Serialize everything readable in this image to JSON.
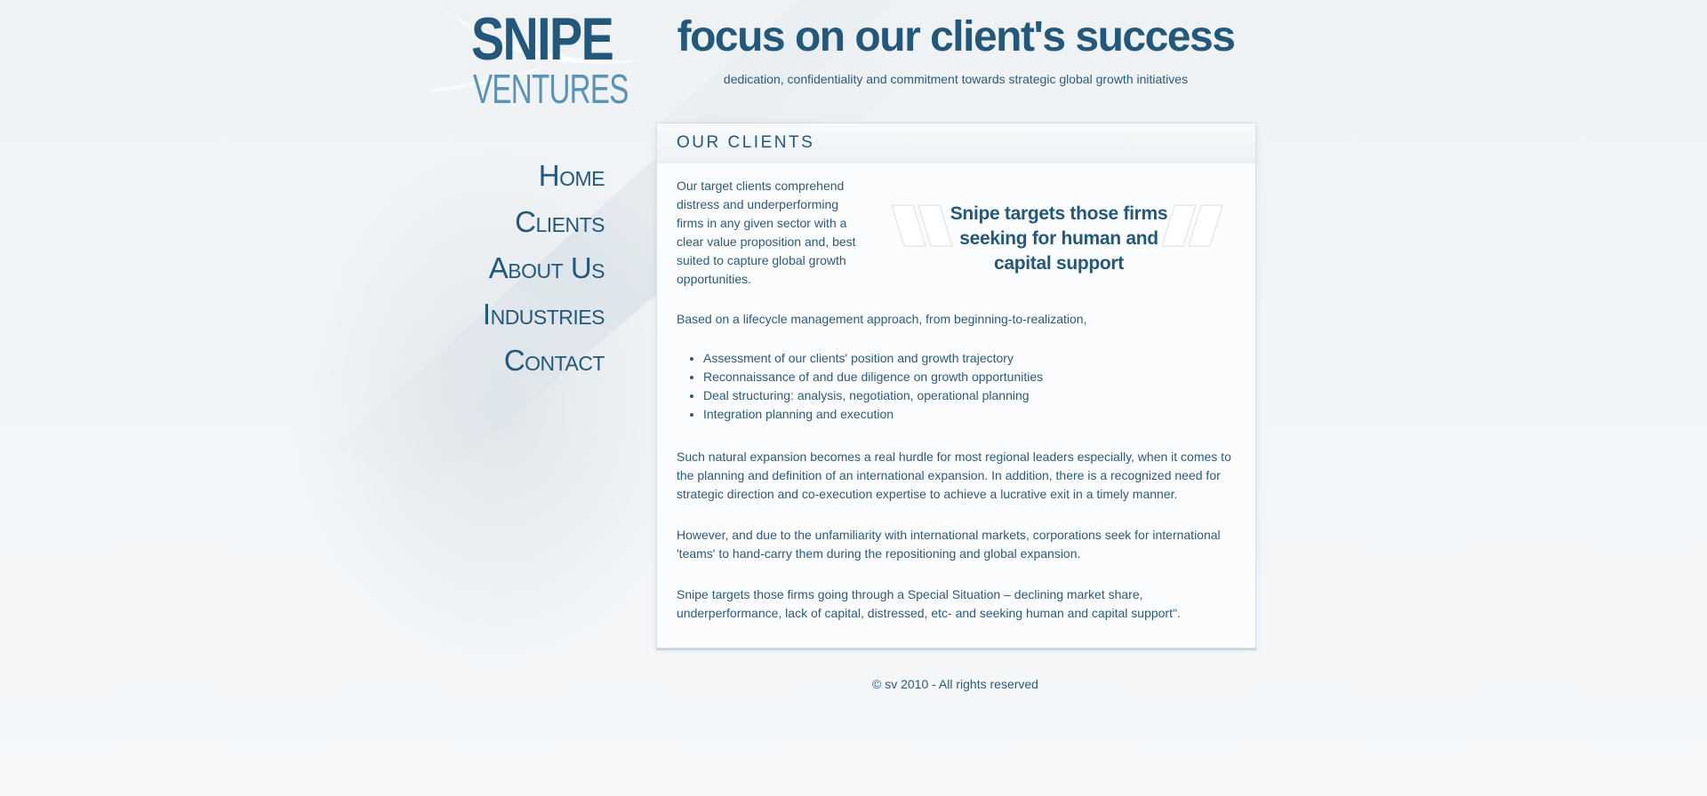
{
  "logo": {
    "line1": "SNIPE",
    "line2": "VENTURES"
  },
  "header": {
    "title": "focus on our client's success",
    "subtitle": "dedication, confidentiality and commitment towards strategic global growth initiatives"
  },
  "nav": {
    "items": [
      {
        "label": "Home"
      },
      {
        "label": "Clients"
      },
      {
        "label": "About Us"
      },
      {
        "label": "Industries"
      },
      {
        "label": "Contact"
      }
    ]
  },
  "main": {
    "title": "OUR CLIENTS",
    "intro": "Our target clients comprehend distress and underperforming firms in any given sector with a clear value proposition and, best suited to capture global growth opportunities.",
    "quote": "Snipe targets those firms seeking for human and capital support",
    "lifecycle_intro": "Based on a lifecycle management approach, from beginning-to-realization,",
    "bullets": [
      "Assessment of our clients' position and growth trajectory",
      "Reconnaissance of and due diligence on growth opportunities",
      "Deal structuring: analysis, negotiation, operational planning",
      "Integration planning and execution"
    ],
    "paragraph_expansion": "Such natural expansion becomes a real hurdle for most regional leaders especially, when it comes to the planning and definition of an international expansion. In addition, there is a recognized need for strategic direction and co-execution expertise to achieve a lucrative exit in a timely manner.",
    "paragraph_international": "However, and due to the unfamiliarity with international markets, corporations seek for international 'teams' to hand-carry them during the repositioning and global expansion.",
    "paragraph_targets": "Snipe targets those firms going through a Special Situation – declining market share, underperformance, lack of capital, distressed, etc- and seeking human and capital support\"."
  },
  "footer": {
    "copyright": "© sv 2010 - All rights reserved"
  },
  "colors": {
    "brand_dark": "#24587a",
    "brand_light": "#5b93b5",
    "text": "#2d5a78",
    "background": "#f4f6f8"
  }
}
